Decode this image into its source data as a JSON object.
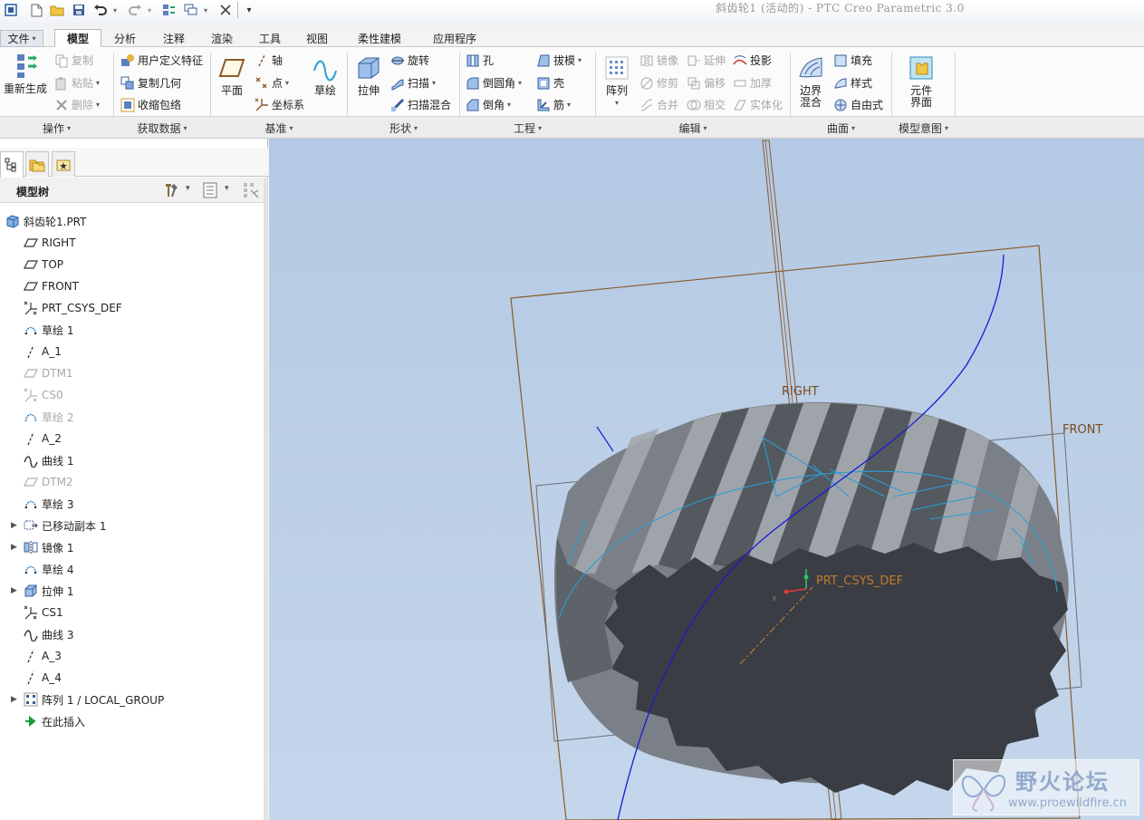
{
  "window": {
    "title": "斜齿轮1 (活动的) - PTC Creo Parametric 3.0"
  },
  "menu_tabs": [
    {
      "label": "文件"
    },
    {
      "label": "模型"
    },
    {
      "label": "分析"
    },
    {
      "label": "注释"
    },
    {
      "label": "渲染"
    },
    {
      "label": "工具"
    },
    {
      "label": "视图"
    },
    {
      "label": "柔性建模"
    },
    {
      "label": "应用程序"
    }
  ],
  "ribbon": {
    "operations": {
      "regenerate": "重新生成",
      "copy": "复制",
      "paste": "粘贴",
      "delete": "删除"
    },
    "get_data": {
      "udf": "用户定义特征",
      "copy_geom": "复制几何",
      "shrinkwrap": "收缩包络"
    },
    "datum": {
      "plane": "平面",
      "axis": "轴",
      "point": "点",
      "csys": "坐标系",
      "sketch": "草绘"
    },
    "shapes": {
      "extrude": "拉伸",
      "revolve": "旋转",
      "sweep": "扫描",
      "swept_blend": "扫描混合"
    },
    "engineering": {
      "hole": "孔",
      "round": "倒圆角",
      "chamfer": "倒角",
      "draft": "拔模",
      "shell": "壳",
      "rib": "筋"
    },
    "editing": {
      "pattern": "阵列",
      "mirror": "镜像",
      "extend": "延伸",
      "project": "投影",
      "trim": "修剪",
      "offset": "偏移",
      "thicken": "加厚",
      "merge": "合并",
      "intersect": "相交",
      "solidify": "实体化"
    },
    "surfaces": {
      "boundary_blend": "边界混合",
      "fill": "填充",
      "style": "样式",
      "freestyle": "自由式"
    },
    "model_intent": {
      "component_interface": "元件界面"
    }
  },
  "group_labels": {
    "operations": "操作",
    "get_data": "获取数据",
    "datum": "基准",
    "shapes": "形状",
    "engineering": "工程",
    "editing": "编辑",
    "surfaces": "曲面",
    "model_intent": "模型意图"
  },
  "model_tree": {
    "header": "模型树",
    "items": [
      {
        "label": "斜齿轮1.PRT",
        "icon": "part-icon",
        "suppressed": false,
        "expandable": false
      },
      {
        "label": "RIGHT",
        "icon": "datum-plane-icon",
        "suppressed": false,
        "expandable": false
      },
      {
        "label": "TOP",
        "icon": "datum-plane-icon",
        "suppressed": false,
        "expandable": false
      },
      {
        "label": "FRONT",
        "icon": "datum-plane-icon",
        "suppressed": false,
        "expandable": false
      },
      {
        "label": "PRT_CSYS_DEF",
        "icon": "csys-icon",
        "suppressed": false,
        "expandable": false
      },
      {
        "label": "草绘 1",
        "icon": "sketch-icon",
        "suppressed": false,
        "expandable": false
      },
      {
        "label": "A_1",
        "icon": "datum-axis-icon",
        "suppressed": false,
        "expandable": false
      },
      {
        "label": "DTM1",
        "icon": "datum-plane-icon",
        "suppressed": true,
        "expandable": false
      },
      {
        "label": "CS0",
        "icon": "csys-icon",
        "suppressed": true,
        "expandable": false
      },
      {
        "label": "草绘 2",
        "icon": "sketch-icon",
        "suppressed": true,
        "expandable": false
      },
      {
        "label": "A_2",
        "icon": "datum-axis-icon",
        "suppressed": false,
        "expandable": false
      },
      {
        "label": "曲线 1",
        "icon": "curve-icon",
        "suppressed": false,
        "expandable": false
      },
      {
        "label": "DTM2",
        "icon": "datum-plane-icon",
        "suppressed": true,
        "expandable": false
      },
      {
        "label": "草绘 3",
        "icon": "sketch-icon",
        "suppressed": false,
        "expandable": false
      },
      {
        "label": "已移动副本 1",
        "icon": "moved-copy-icon",
        "suppressed": false,
        "expandable": true
      },
      {
        "label": "镜像 1",
        "icon": "mirror-icon",
        "suppressed": false,
        "expandable": true
      },
      {
        "label": "草绘 4",
        "icon": "sketch-icon",
        "suppressed": false,
        "expandable": false
      },
      {
        "label": "拉伸 1",
        "icon": "extrude-icon",
        "suppressed": false,
        "expandable": true
      },
      {
        "label": "CS1",
        "icon": "csys-icon",
        "suppressed": false,
        "expandable": false
      },
      {
        "label": "曲线 3",
        "icon": "curve-icon",
        "suppressed": false,
        "expandable": false
      },
      {
        "label": "A_3",
        "icon": "datum-axis-icon",
        "suppressed": false,
        "expandable": false
      },
      {
        "label": "A_4",
        "icon": "datum-axis-icon",
        "suppressed": false,
        "expandable": false
      },
      {
        "label": "阵列 1 / LOCAL_GROUP",
        "icon": "pattern-icon",
        "suppressed": false,
        "expandable": true
      },
      {
        "label": "在此插入",
        "icon": "insert-here-icon",
        "suppressed": false,
        "expandable": false
      }
    ]
  },
  "viewport": {
    "labels": {
      "right": "RIGHT",
      "front": "FRONT",
      "csys": "PRT_CSYS_DEF"
    }
  },
  "watermark": {
    "title": "野火论坛",
    "url": "www.proewildfire.cn"
  },
  "colors": {
    "datum_plane": "#8a5a2b",
    "curve_blue": "#1a1ad6",
    "sketch_cyan": "#2a9fd0",
    "gear_gray": "#6e737b",
    "viewport_bg": "#b8cde6"
  }
}
